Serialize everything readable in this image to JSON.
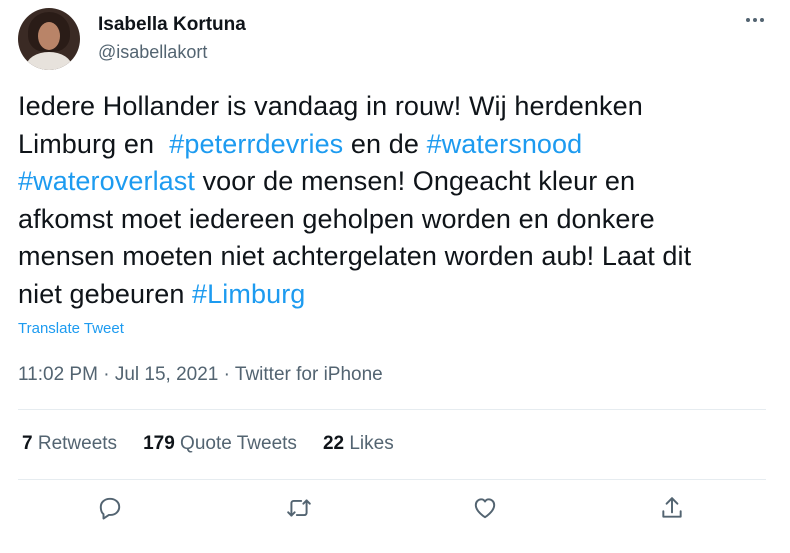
{
  "author": {
    "display_name": "Isabella Kortuna",
    "handle": "@isabellakort"
  },
  "tweet": {
    "line1": "Iedere Hollander is vandaag in rouw! Wij herdenken",
    "line2_a": "Limburg en ",
    "line2_tag1": "#peterrdevries",
    "line2_b": " en de ",
    "line2_tag2": "#watersnood",
    "line3_tag": "#wateroverlast",
    "line3_b": " voor de mensen! Ongeacht kleur en",
    "line4": "afkomst moet iedereen geholpen worden en donkere",
    "line5": "mensen moeten niet achtergelaten worden aub! Laat dit",
    "line6_a": "niet gebeuren ",
    "line6_tag": "#Limburg"
  },
  "translate_label": "Translate Tweet",
  "meta": {
    "time": "11:02 PM",
    "sep1": " · ",
    "date": "Jul 15, 2021",
    "sep2": " · ",
    "source": "Twitter for iPhone"
  },
  "stats": {
    "retweets_count": "7",
    "retweets_label": "Retweets",
    "quotes_count": "179",
    "quotes_label": "Quote Tweets",
    "likes_count": "22",
    "likes_label": "Likes"
  },
  "icons": {
    "reply": "reply-icon",
    "retweet": "retweet-icon",
    "like": "heart-icon",
    "share": "share-icon",
    "more": "more-icon"
  },
  "colors": {
    "link": "#1d9bf0",
    "secondary_text": "#536471",
    "primary_text": "#0f1419",
    "divider": "#e6ecf0"
  }
}
